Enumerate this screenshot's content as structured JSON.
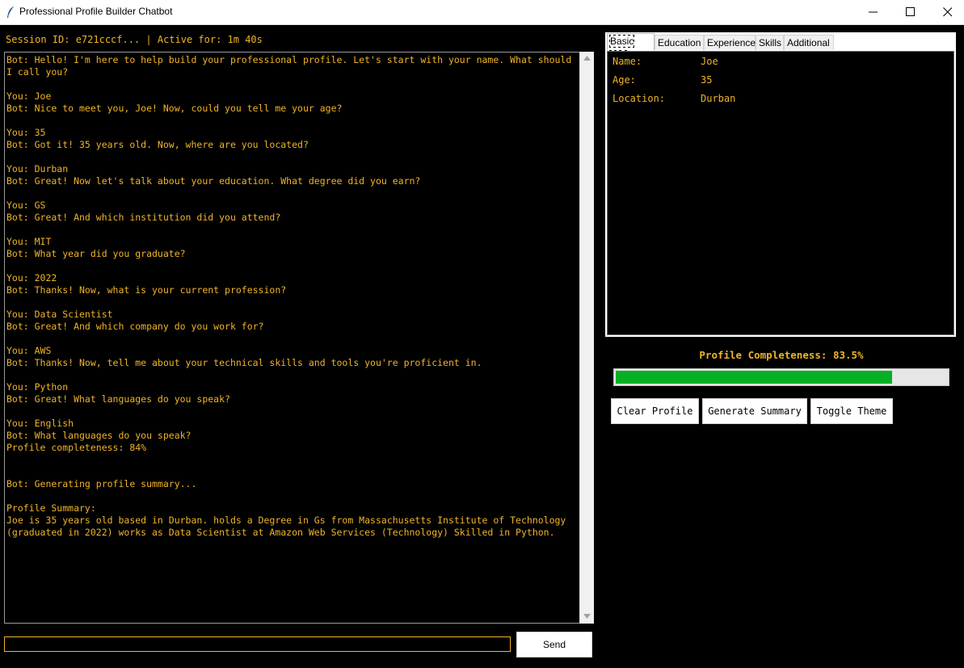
{
  "window": {
    "title": "Professional Profile Builder Chatbot",
    "icon": "feather-icon"
  },
  "session": {
    "text": "Session ID: e721cccf... | Active for: 1m 40s"
  },
  "chat": {
    "transcript": "Bot: Hello! I'm here to help build your professional profile. Let's start with your name. What should I call you?\n\nYou: Joe\nBot: Nice to meet you, Joe! Now, could you tell me your age?\n\nYou: 35\nBot: Got it! 35 years old. Now, where are you located?\n\nYou: Durban\nBot: Great! Now let's talk about your education. What degree did you earn?\n\nYou: GS\nBot: Great! And which institution did you attend?\n\nYou: MIT\nBot: What year did you graduate?\n\nYou: 2022\nBot: Thanks! Now, what is your current profession?\n\nYou: Data Scientist\nBot: Great! And which company do you work for?\n\nYou: AWS\nBot: Thanks! Now, tell me about your technical skills and tools you're proficient in.\n\nYou: Python\nBot: Great! What languages do you speak?\n\nYou: English\nBot: What languages do you speak?\nProfile completeness: 84%\n\n\nBot: Generating profile summary...\n\nProfile Summary:\nJoe is 35 years old based in Durban. holds a Degree in Gs from Massachusetts Institute of Technology (graduated in 2022) works as Data Scientist at Amazon Web Services (Technology) Skilled in Python.",
    "input_value": "",
    "send_label": "Send"
  },
  "tabs": [
    {
      "label": "Basic Info",
      "active": true
    },
    {
      "label": "Education",
      "active": false
    },
    {
      "label": "Experience",
      "active": false
    },
    {
      "label": "Skills",
      "active": false
    },
    {
      "label": "Additional",
      "active": false
    }
  ],
  "basic_info": [
    {
      "label": "Name:",
      "value": "Joe"
    },
    {
      "label": "Age:",
      "value": "35"
    },
    {
      "label": "Location:",
      "value": "Durban"
    }
  ],
  "completeness": {
    "label": "Profile Completeness: 83.5%",
    "percent": 83.5
  },
  "actions": {
    "clear": "Clear Profile",
    "generate": "Generate Summary",
    "theme": "Toggle Theme"
  },
  "colors": {
    "text": "#f0b429",
    "background": "#000000",
    "progress": "#06b025"
  }
}
